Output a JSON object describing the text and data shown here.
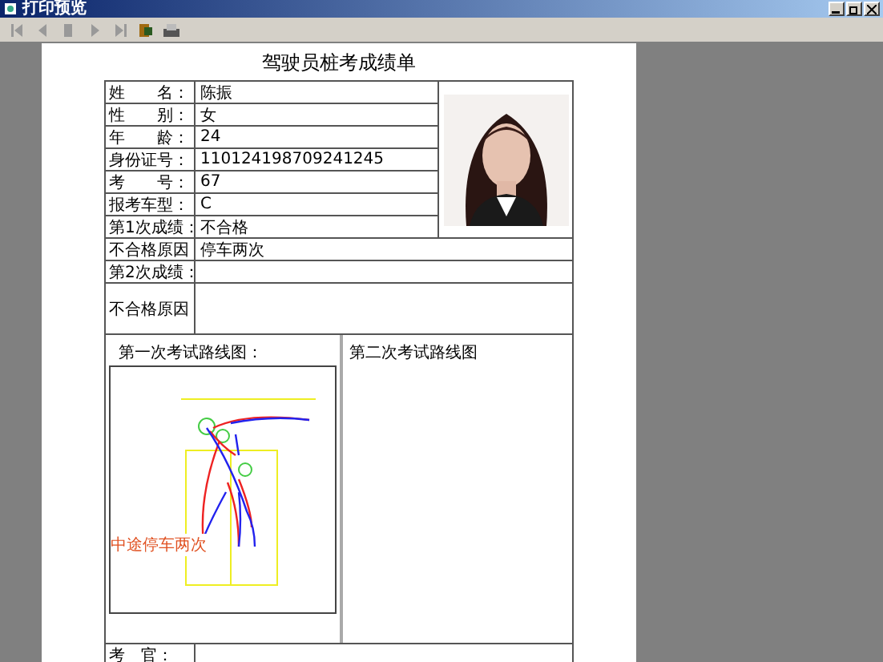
{
  "window": {
    "title": "打印预览"
  },
  "report": {
    "title": "驾驶员桩考成绩单",
    "info_rows": [
      {
        "label": "姓　　名：",
        "value": "陈振"
      },
      {
        "label": "性　　别：",
        "value": "女"
      },
      {
        "label": "年　　龄：",
        "value": "24"
      },
      {
        "label": "身份证号：",
        "value": "110124198709241245"
      },
      {
        "label": "考　　号：",
        "value": "67"
      },
      {
        "label": "报考车型：",
        "value": "C"
      },
      {
        "label": "第1次成绩：",
        "value": "不合格"
      }
    ],
    "extra_rows": [
      {
        "label": "不合格原因",
        "value": "停车两次"
      },
      {
        "label": "第2次成绩："
      },
      {
        "label": "不合格原因",
        "tall": true
      }
    ],
    "diagrams": [
      {
        "caption": "第一次考试路线图：",
        "note": "中途停车两次",
        "has_route": true
      },
      {
        "caption": "第二次考试路线图",
        "has_route": false
      }
    ],
    "examiner": {
      "label": "考　官："
    }
  }
}
